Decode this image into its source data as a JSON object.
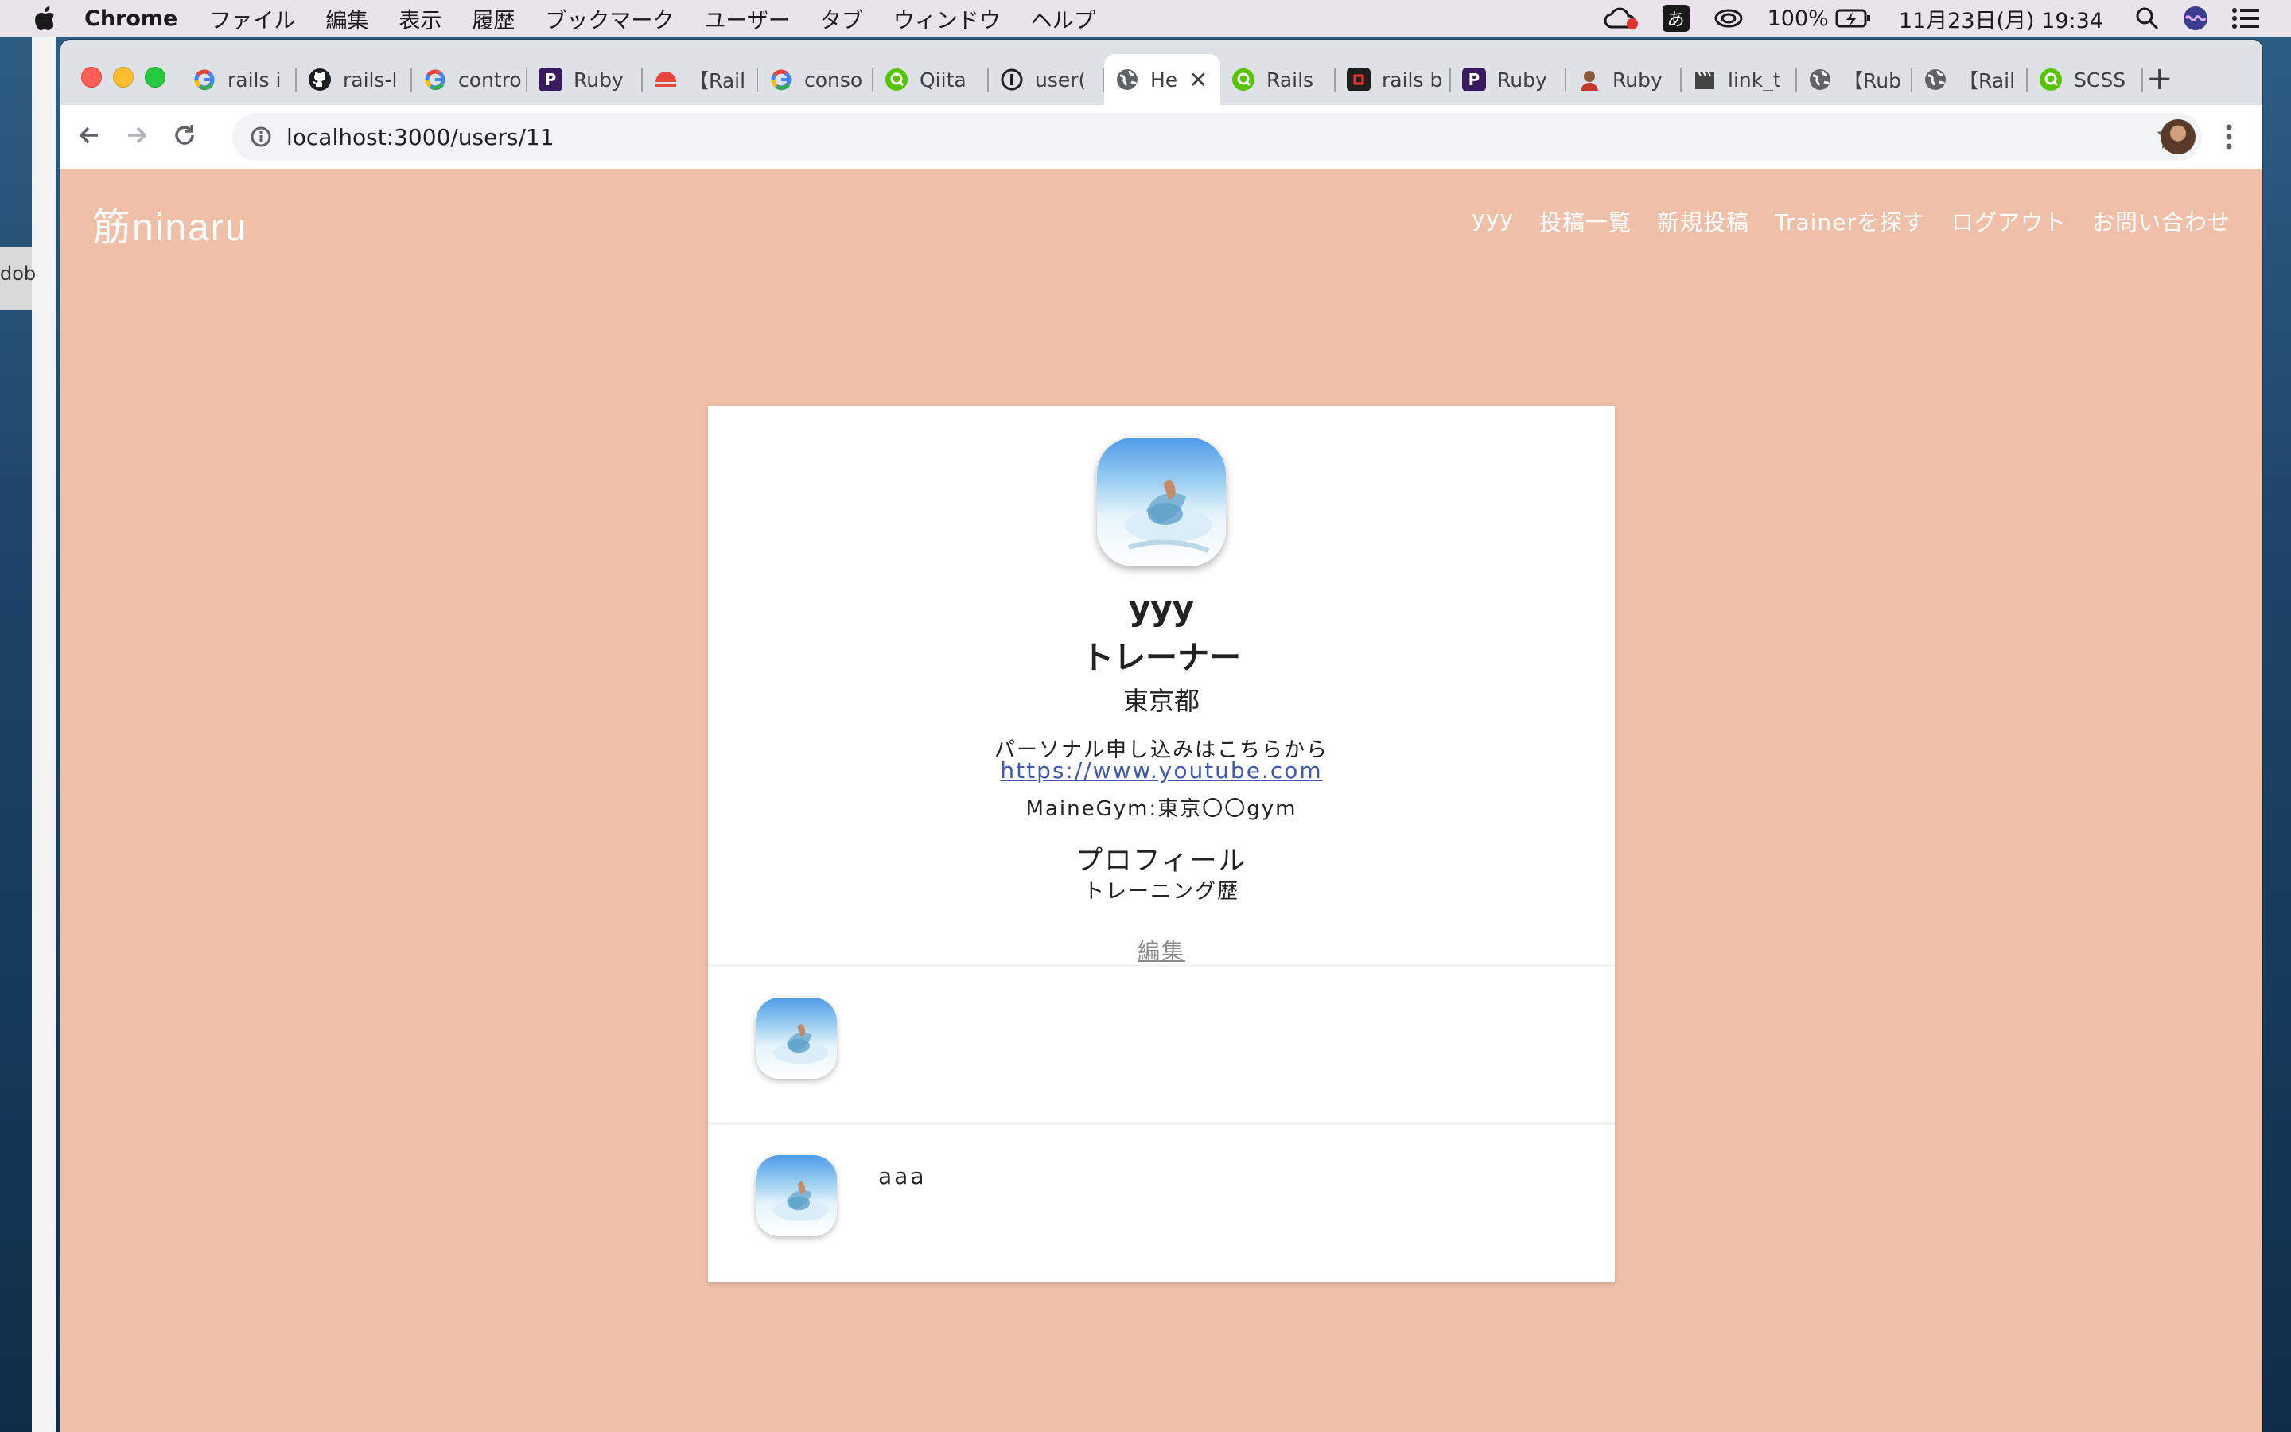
{
  "menubar": {
    "app_name": "Chrome",
    "menus": [
      "ファイル",
      "編集",
      "表示",
      "履歴",
      "ブックマーク",
      "ユーザー",
      "タブ",
      "ウィンドウ",
      "ヘルプ"
    ],
    "ime": "あ",
    "battery": "100%",
    "datetime": "11月23日(月)  19:34"
  },
  "desktop": {
    "partial_text": "dob"
  },
  "browser": {
    "tabs": [
      {
        "label": "rails i",
        "icon": "google-icon"
      },
      {
        "label": "rails-l",
        "icon": "github-icon"
      },
      {
        "label": "contro",
        "icon": "google-icon"
      },
      {
        "label": "Ruby",
        "icon": "p-icon"
      },
      {
        "label": "【Rail",
        "icon": "sunset-icon"
      },
      {
        "label": "conso",
        "icon": "google-icon"
      },
      {
        "label": "Qiita",
        "icon": "qiita-icon"
      },
      {
        "label": "user(",
        "icon": "info-icon"
      },
      {
        "label": "He",
        "icon": "globe-icon",
        "active": true
      },
      {
        "label": "Rails",
        "icon": "qiita-icon"
      },
      {
        "label": "rails b",
        "icon": "square-icon"
      },
      {
        "label": "Ruby",
        "icon": "p-icon"
      },
      {
        "label": "Ruby",
        "icon": "avatar-icon"
      },
      {
        "label": "link_t",
        "icon": "clapper-icon"
      },
      {
        "label": "【Rub",
        "icon": "globe-icon"
      },
      {
        "label": "【Rail",
        "icon": "globe-icon"
      },
      {
        "label": "SCSS",
        "icon": "qiita-icon"
      }
    ],
    "url": "localhost:3000/users/11"
  },
  "site": {
    "logo": "筋ninaru",
    "nav": [
      "yyy",
      "投稿一覧",
      "新規投稿",
      "Trainerを探す",
      "ログアウト",
      "お問い合わせ"
    ]
  },
  "profile": {
    "name": "yyy",
    "role": "トレーナー",
    "prefecture": "東京都",
    "apply_text": "パーソナル申し込みはこちらから",
    "link": "https://www.youtube.com",
    "gym": "MaineGym:東京〇〇gym",
    "profile_heading": "プロフィール",
    "profile_text": "トレーニング歴",
    "edit_label": "編集"
  },
  "posts": [
    {
      "text": ""
    },
    {
      "text": "aaa"
    }
  ],
  "colors": {
    "page_bg": "#efbfa8",
    "card_bg": "#ffffff",
    "link": "#3e5aa8"
  }
}
